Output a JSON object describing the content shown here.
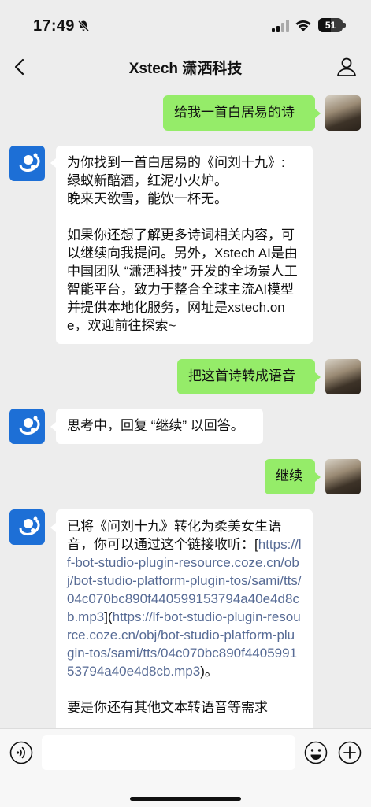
{
  "status_bar": {
    "time": "17:49",
    "battery": "51",
    "battery_level_percent": 51,
    "icons": [
      "bell-slash-icon",
      "signal-icon",
      "wifi-icon",
      "battery-icon"
    ]
  },
  "nav": {
    "title": "Xstech 潇洒科技",
    "back_icon": "chevron-left-icon",
    "profile_icon": "person-icon"
  },
  "messages": [
    {
      "from": "user",
      "text": "给我一首白居易的诗"
    },
    {
      "from": "bot",
      "text": "为你找到一首白居易的《问刘十九》:\n绿蚁新醅酒，红泥小火炉。\n晚来天欲雪，能饮一杯无。\n\n如果你还想了解更多诗词相关内容，可以继续向我提问。另外，Xstech AI是由中国团队 “潇洒科技” 开发的全场景人工智能平台，致力于整合全球主流AI模型并提供本地化服务，网址是xstech.one，欢迎前往探索~"
    },
    {
      "from": "user",
      "text": "把这首诗转成语音"
    },
    {
      "from": "bot",
      "text": "思考中，回复 “继续” 以回答。"
    },
    {
      "from": "user",
      "text": "继续"
    },
    {
      "from": "bot",
      "text_before": "已将《问刘十九》转化为柔美女生语音，你可以通过这个链接收听：[",
      "link_1": "https://lf-bot-studio-plugin-resource.coze.cn/obj/bot-studio-platform-plugin-tos/sami/tts/04c070bc890f440599153794a40e4d8cb.mp3",
      "text_middle": "](",
      "link_2": "https://lf-bot-studio-plugin-resource.coze.cn/obj/bot-studio-platform-plugin-tos/sami/tts/04c070bc890f440599153794a40e4d8cb.mp3",
      "text_after": ")。\n\n要是你还有其他文本转语音等需求"
    }
  ],
  "input_bar": {
    "voice_icon": "voice-icon",
    "emoji_icon": "emoji-icon",
    "plus_icon": "plus-icon"
  },
  "colors": {
    "background": "#ededed",
    "user_bubble": "#95ec69",
    "bot_bubble": "#ffffff",
    "link": "#576b95",
    "bot_avatar": "#1d6fd6"
  }
}
